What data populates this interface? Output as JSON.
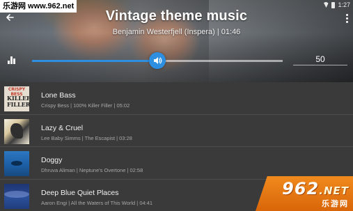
{
  "watermark": {
    "top_text": "乐游网 www.962.net",
    "corner_brand": "962",
    "corner_net": ".NET",
    "corner_sub": "乐游网"
  },
  "status_bar": {
    "time": "1:27",
    "icons": [
      "wifi-icon",
      "battery-icon"
    ]
  },
  "player": {
    "title": "Vintage theme music",
    "subtitle": "Benjamin Westerfjell (Inspera) | 01:46",
    "volume_level_percent": 50,
    "volume_value_text": "50",
    "accent_color": "#2e8fe0",
    "icons": {
      "back": "back-arrow-icon",
      "menu": "overflow-menu-icon",
      "equalizer": "equalizer-icon",
      "volume": "speaker-icon"
    }
  },
  "tracks": [
    {
      "title": "Lone Bass",
      "meta": "Crispy Bess | 100% Killer Filler | 05:02",
      "cover_text_top": "CRISPY BESS",
      "cover_text_main": "KILLER FILLER"
    },
    {
      "title": "Lazy & Cruel",
      "meta": "Lee Baby Simms | The Escapist | 03:28"
    },
    {
      "title": "Doggy",
      "meta": "Dhruva Aliman | Neptune's Overtone | 02:58"
    },
    {
      "title": "Deep Blue Quiet Places",
      "meta": "Aaron Engi | All the Waters of This World | 04:41"
    }
  ]
}
